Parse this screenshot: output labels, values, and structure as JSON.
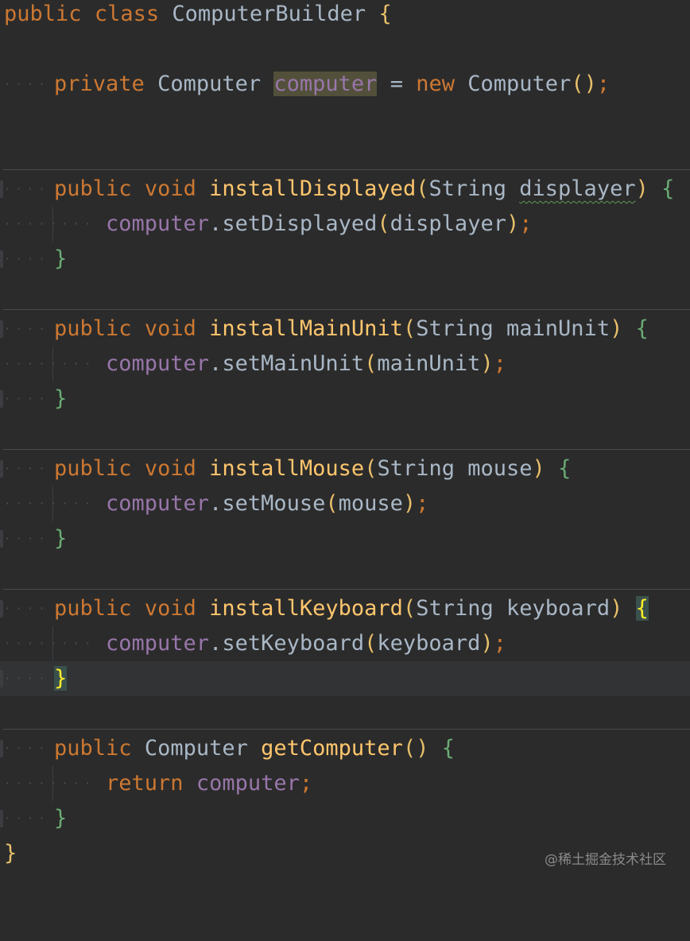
{
  "code": {
    "class_decl": {
      "kw_public": "public",
      "kw_class": "class",
      "name": "ComputerBuilder",
      "open": "{"
    },
    "field": {
      "kw_private": "private",
      "type": "Computer",
      "name": "computer",
      "eq": "=",
      "kw_new": "new",
      "ctor": "Computer",
      "parens": "()",
      "semi": ";"
    },
    "methods": [
      {
        "kw_public": "public",
        "kw_void": "void",
        "name": "installDisplayed",
        "lparen": "(",
        "ptype": "String",
        "pname": "displayer",
        "rparen": ")",
        "open": "{",
        "body_field": "computer",
        "dot": ".",
        "call": "setDisplayed",
        "arg_open": "(",
        "arg": "displayer",
        "arg_close": ")",
        "semi": ";",
        "close": "}"
      },
      {
        "kw_public": "public",
        "kw_void": "void",
        "name": "installMainUnit",
        "lparen": "(",
        "ptype": "String",
        "pname": "mainUnit",
        "rparen": ")",
        "open": "{",
        "body_field": "computer",
        "dot": ".",
        "call": "setMainUnit",
        "arg_open": "(",
        "arg": "mainUnit",
        "arg_close": ")",
        "semi": ";",
        "close": "}"
      },
      {
        "kw_public": "public",
        "kw_void": "void",
        "name": "installMouse",
        "lparen": "(",
        "ptype": "String",
        "pname": "mouse",
        "rparen": ")",
        "open": "{",
        "body_field": "computer",
        "dot": ".",
        "call": "setMouse",
        "arg_open": "(",
        "arg": "mouse",
        "arg_close": ")",
        "semi": ";",
        "close": "}"
      },
      {
        "kw_public": "public",
        "kw_void": "void",
        "name": "installKeyboard",
        "lparen": "(",
        "ptype": "String",
        "pname": "keyboard",
        "rparen": ")",
        "open": "{",
        "body_field": "computer",
        "dot": ".",
        "call": "setKeyboard",
        "arg_open": "(",
        "arg": "keyboard",
        "arg_close": ")",
        "semi": ";",
        "close": "}"
      }
    ],
    "getter": {
      "kw_public": "public",
      "type": "Computer",
      "name": "getComputer",
      "parens": "()",
      "open": "{",
      "kw_return": "return",
      "field": "computer",
      "semi": ";",
      "close": "}"
    },
    "class_close": "}"
  },
  "indent_dots": {
    "level1": "····",
    "level2": "········"
  },
  "watermark": "@稀土掘金技术社区",
  "colors": {
    "background": "#2b2b2b",
    "keyword": "#cc7832",
    "function": "#ffc66d",
    "field": "#9876aa",
    "text": "#a9b7c6",
    "brace": "#6aab73",
    "paren": "#e8bf6a"
  }
}
